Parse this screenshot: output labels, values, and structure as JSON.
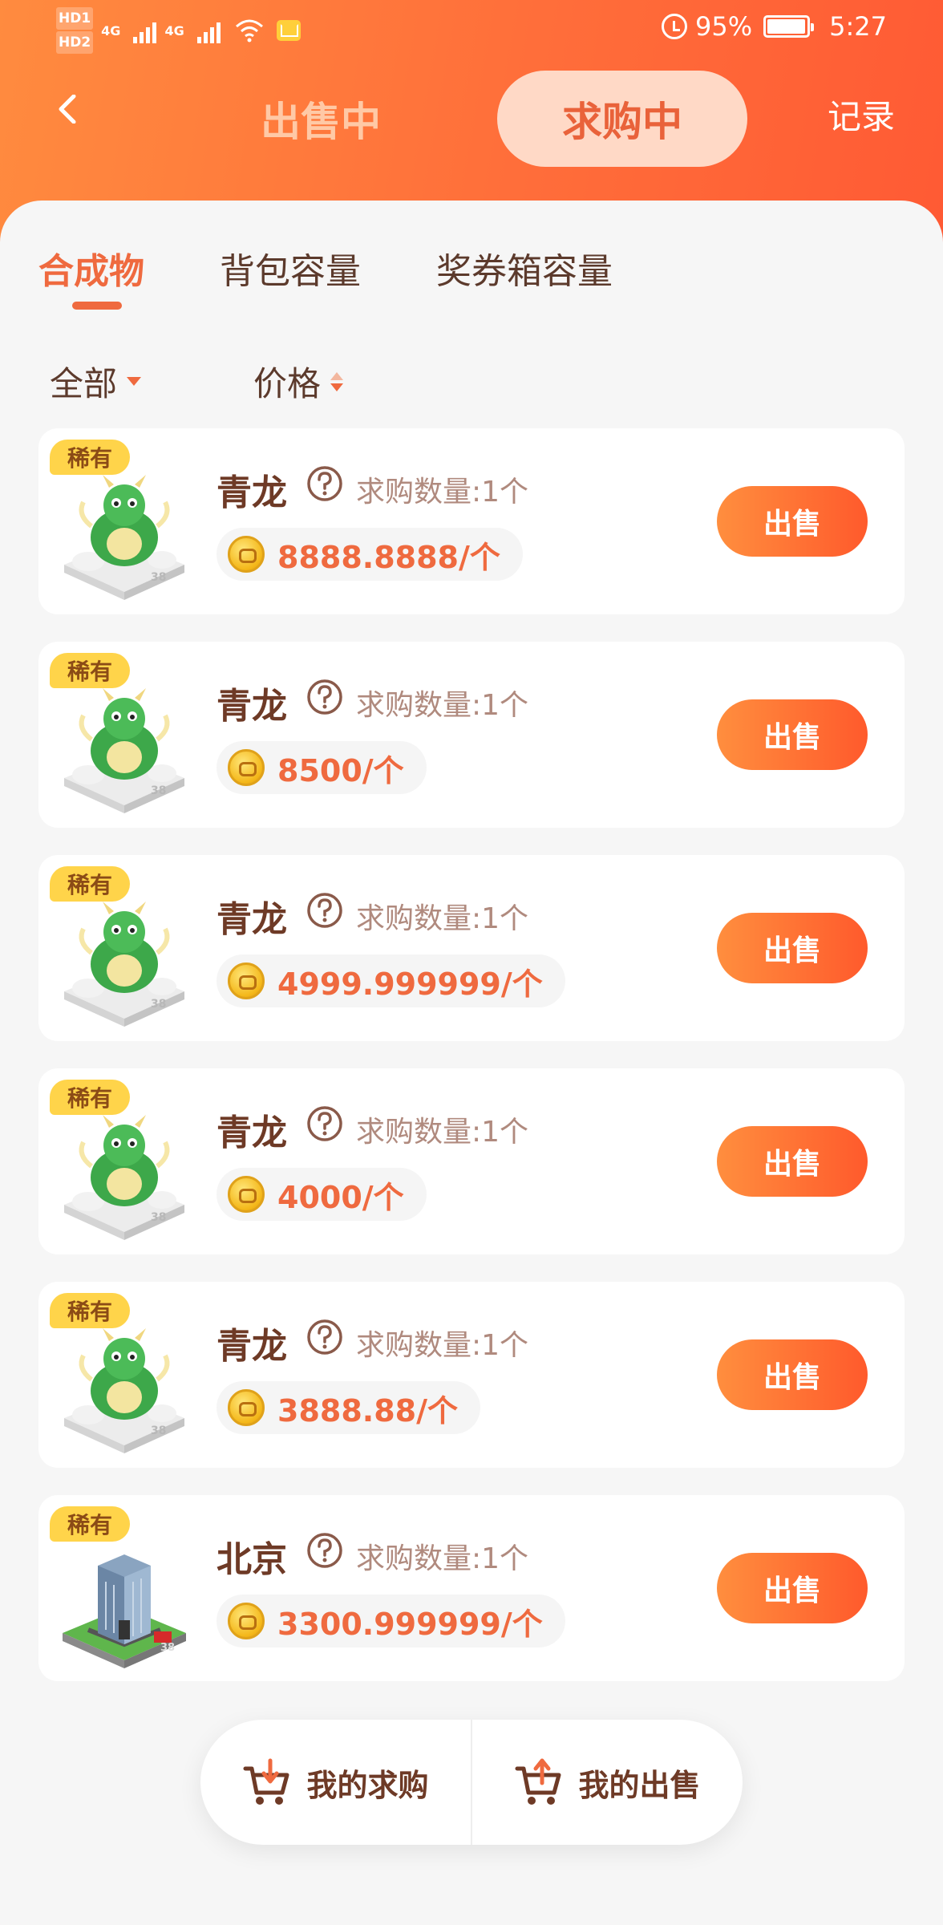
{
  "status_bar": {
    "hd1": "HD1",
    "hd2": "HD2",
    "net1": "4G",
    "net2": "4G",
    "battery": "95%",
    "time": "5:27"
  },
  "nav": {
    "tab_selling": "出售中",
    "tab_buying": "求购中",
    "record": "记录"
  },
  "category_tabs": [
    "合成物",
    "背包容量",
    "奖券箱容量"
  ],
  "filters": {
    "all": "全部",
    "price": "价格"
  },
  "listings": [
    {
      "badge": "稀有",
      "name": "青龙",
      "qty": "求购数量:1个",
      "price": "8888.8888/个",
      "button": "出售",
      "image": "green-dragon"
    },
    {
      "badge": "稀有",
      "name": "青龙",
      "qty": "求购数量:1个",
      "price": "8500/个",
      "button": "出售",
      "image": "green-dragon"
    },
    {
      "badge": "稀有",
      "name": "青龙",
      "qty": "求购数量:1个",
      "price": "4999.999999/个",
      "button": "出售",
      "image": "green-dragon"
    },
    {
      "badge": "稀有",
      "name": "青龙",
      "qty": "求购数量:1个",
      "price": "4000/个",
      "button": "出售",
      "image": "green-dragon"
    },
    {
      "badge": "稀有",
      "name": "青龙",
      "qty": "求购数量:1个",
      "price": "3888.88/个",
      "button": "出售",
      "image": "green-dragon"
    },
    {
      "badge": "稀有",
      "name": "北京",
      "qty": "求购数量:1个",
      "price": "3300.999999/个",
      "button": "出售",
      "image": "beijing-building"
    }
  ],
  "bottom_bar": {
    "my_buy": "我的求购",
    "my_sell": "我的出售"
  },
  "colors": {
    "accent": "#ef6a3f",
    "header_start": "#ff8b3f",
    "header_end": "#ff5a34",
    "badge": "#ffd44a",
    "text_dark": "#6e3a26"
  }
}
